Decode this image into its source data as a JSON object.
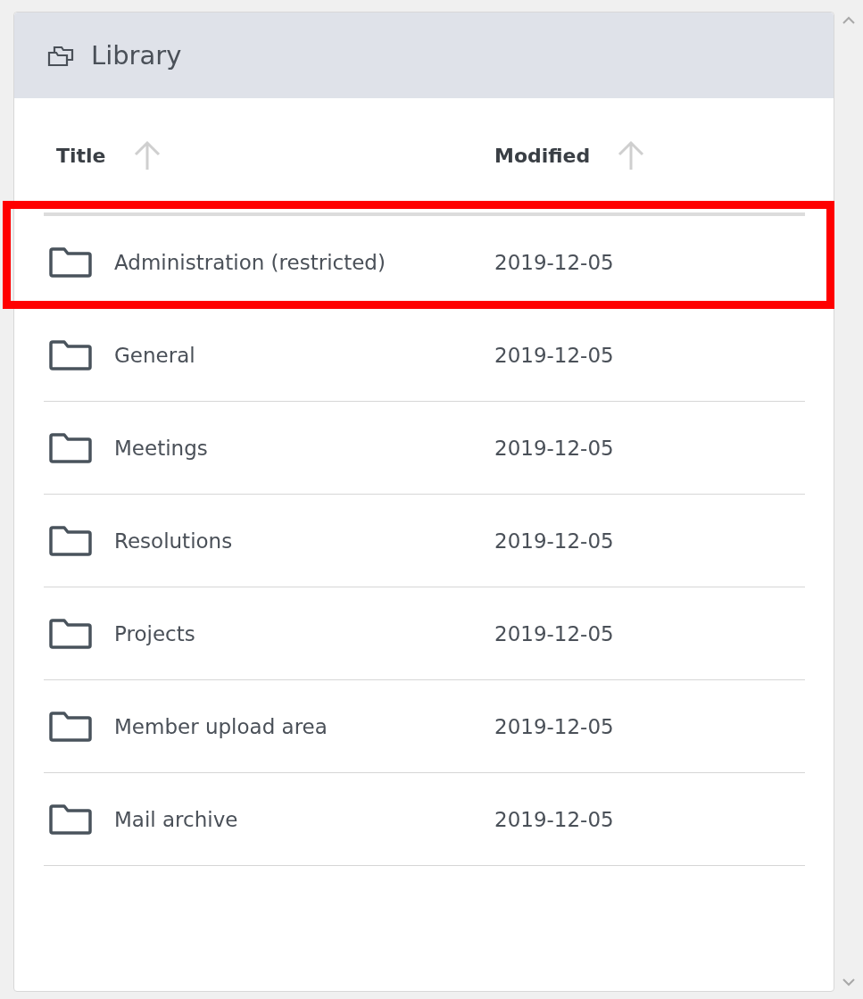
{
  "panel": {
    "title": "Library"
  },
  "table": {
    "columns": [
      {
        "label": "Title",
        "sorted": true
      },
      {
        "label": "Modified",
        "sorted": true
      }
    ],
    "rows": [
      {
        "title": "Administration (restricted)",
        "modified": "2019-12-05",
        "highlighted": true
      },
      {
        "title": "General",
        "modified": "2019-12-05",
        "highlighted": false
      },
      {
        "title": "Meetings",
        "modified": "2019-12-05",
        "highlighted": false
      },
      {
        "title": "Resolutions",
        "modified": "2019-12-05",
        "highlighted": false
      },
      {
        "title": "Projects",
        "modified": "2019-12-05",
        "highlighted": false
      },
      {
        "title": "Member upload area",
        "modified": "2019-12-05",
        "highlighted": false
      },
      {
        "title": "Mail archive",
        "modified": "2019-12-05",
        "highlighted": false
      }
    ]
  }
}
